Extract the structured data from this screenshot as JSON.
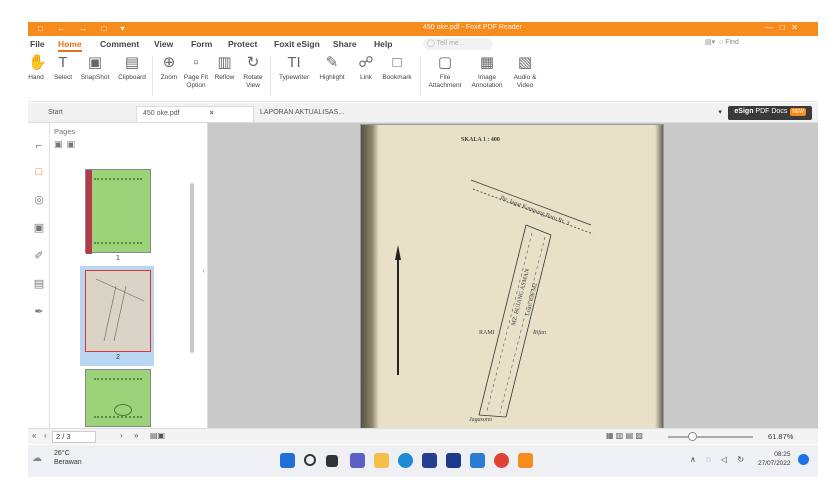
{
  "window": {
    "title_fragment": "450 oke.pdf - Foxit PDF Reader",
    "quick_access": "□ ← → □ ▾"
  },
  "menu": {
    "items": [
      "File",
      "Home",
      "Comment",
      "View",
      "Form",
      "Protect",
      "Foxit eSign",
      "Share",
      "Help"
    ],
    "active": "Home",
    "tell_me": "Tell me...",
    "find": "Find"
  },
  "ribbon": {
    "tools": [
      {
        "label": "Hand",
        "icon": "hand-icon",
        "glyph": "✋"
      },
      {
        "label": "Select",
        "icon": "select-text-icon",
        "glyph": "T"
      },
      {
        "label": "SnapShot",
        "icon": "snapshot-icon",
        "glyph": "▣"
      },
      {
        "label": "Clipboard",
        "icon": "clipboard-icon",
        "glyph": "▤"
      },
      {
        "label": "Zoom",
        "icon": "zoom-icon",
        "glyph": "⊕"
      },
      {
        "label": "Page Fit Option",
        "icon": "page-fit-icon",
        "glyph": "▫"
      },
      {
        "label": "Reflow",
        "icon": "reflow-icon",
        "glyph": "▥"
      },
      {
        "label": "Rotate View",
        "icon": "rotate-view-icon",
        "glyph": "↻"
      },
      {
        "label": "Typewriter",
        "icon": "typewriter-icon",
        "glyph": "TI"
      },
      {
        "label": "Highlight",
        "icon": "highlight-icon",
        "glyph": "✎"
      },
      {
        "label": "Link",
        "icon": "link-icon",
        "glyph": "☍"
      },
      {
        "label": "Bookmark",
        "icon": "bookmark-icon",
        "glyph": "□"
      },
      {
        "label": "File Attachment",
        "icon": "file-attachment-icon",
        "glyph": "▢"
      },
      {
        "label": "Image Annotation",
        "icon": "image-annotation-icon",
        "glyph": "▦"
      },
      {
        "label": "Audio & Video",
        "icon": "audio-video-icon",
        "glyph": "▧"
      }
    ]
  },
  "tabs": [
    {
      "label": "Start",
      "active": false
    },
    {
      "label": "450 oke.pdf",
      "active": true,
      "close": "×"
    },
    {
      "label": "LAPORAN AKTUALISAS...",
      "active": false
    }
  ],
  "esign": {
    "brand": "eSign",
    "label": "PDF Docs",
    "badge": "NEW"
  },
  "pages_panel": {
    "header": "Pages",
    "thumbnails": [
      {
        "label": "1",
        "selected": false
      },
      {
        "label": "2",
        "selected": true
      },
      {
        "label": "",
        "selected": false
      }
    ]
  },
  "document": {
    "scale_text": "SKALA 1 : 400",
    "road_label": "Jln. Jagat Kampung Baru Rt. 3",
    "vertical_text": "MZ. BUJANG ASMAN",
    "sub_vertical": "Luas: 836 M2",
    "left_label": "RAMI",
    "right_label": "Rifan",
    "bottom_label": "Jagasono"
  },
  "navbar": {
    "current_page": "2 / 3",
    "first": "«",
    "prev": "‹",
    "next": "›",
    "last": "»",
    "zoom": "61.87%"
  },
  "taskbar": {
    "temperature": "26°C",
    "weather": "Berawan",
    "time": "08:25",
    "date": "27/07/2022"
  },
  "colors": {
    "accent": "#f68b1e",
    "thumb_green": "#9cd27a",
    "selection": "#b8d6f2"
  }
}
